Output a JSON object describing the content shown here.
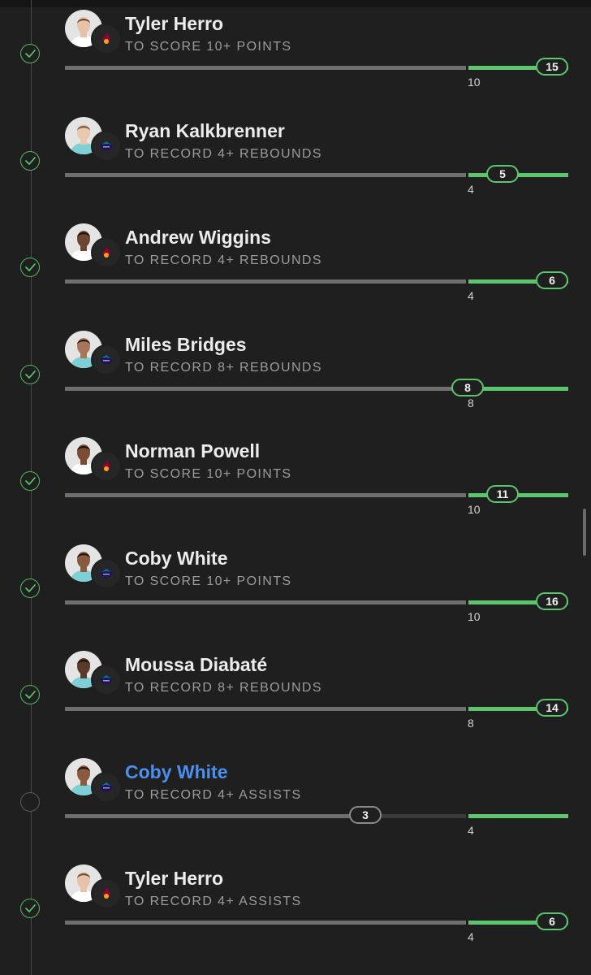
{
  "legs": [
    {
      "player": "Tyler Herro",
      "prop": "TO SCORE 10+ POINTS",
      "line": "10",
      "value": "15",
      "status": "hit",
      "team": "miami-heat",
      "jersey": "#ffffff",
      "skin": "#e8c2a8",
      "hair": "#6b4a2e",
      "progress": 1.0,
      "name_style": "default"
    },
    {
      "player": "Ryan Kalkbrenner",
      "prop": "TO RECORD 4+ REBOUNDS",
      "line": "4",
      "value": "5",
      "status": "hit",
      "team": "charlotte-hornets",
      "jersey": "#7fd0d6",
      "skin": "#e9c8b0",
      "hair": "#7a5634",
      "progress": 1.0,
      "name_style": "default"
    },
    {
      "player": "Andrew Wiggins",
      "prop": "TO RECORD 4+ REBOUNDS",
      "line": "4",
      "value": "6",
      "status": "hit",
      "team": "miami-heat",
      "jersey": "#ffffff",
      "skin": "#6e4530",
      "hair": "#1b1210",
      "progress": 1.0,
      "name_style": "default"
    },
    {
      "player": "Miles Bridges",
      "prop": "TO RECORD 8+ REBOUNDS",
      "line": "8",
      "value": "8",
      "status": "hit",
      "team": "charlotte-hornets",
      "jersey": "#7fd0d6",
      "skin": "#a8775a",
      "hair": "#231914",
      "progress": 1.0,
      "name_style": "default"
    },
    {
      "player": "Norman Powell",
      "prop": "TO SCORE 10+ POINTS",
      "line": "10",
      "value": "11",
      "status": "hit",
      "team": "miami-heat",
      "jersey": "#ffffff",
      "skin": "#7b4b33",
      "hair": "#1b1210",
      "progress": 1.0,
      "name_style": "default"
    },
    {
      "player": "Coby White",
      "prop": "TO SCORE 10+ POINTS",
      "line": "10",
      "value": "16",
      "status": "hit",
      "team": "charlotte-hornets",
      "jersey": "#7fd0d6",
      "skin": "#8a5a3f",
      "hair": "#1b1210",
      "progress": 1.0,
      "name_style": "default"
    },
    {
      "player": "Moussa Diabaté",
      "prop": "TO RECORD 8+ REBOUNDS",
      "line": "8",
      "value": "14",
      "status": "hit",
      "team": "charlotte-hornets",
      "jersey": "#7fd0d6",
      "skin": "#5c3a28",
      "hair": "#1b1210",
      "progress": 1.0,
      "name_style": "default"
    },
    {
      "player": "Coby White",
      "prop": "TO RECORD 4+ ASSISTS",
      "line": "4",
      "value": "3",
      "status": "pending",
      "team": "charlotte-hornets",
      "jersey": "#7fd0d6",
      "skin": "#8a5a3f",
      "hair": "#1b1210",
      "progress": 0.75,
      "name_style": "link"
    },
    {
      "player": "Tyler Herro",
      "prop": "TO RECORD 4+ ASSISTS",
      "line": "4",
      "value": "6",
      "status": "hit",
      "team": "miami-heat",
      "jersey": "#ffffff",
      "skin": "#e8c2a8",
      "hair": "#6b4a2e",
      "progress": 1.0,
      "name_style": "default"
    }
  ],
  "colors": {
    "background": "#1f1f1f",
    "hit": "#5cc66e",
    "track": "#6f6f6f",
    "pending_track": "#3a3a3a",
    "name": "#ececec",
    "name_link": "#4c8fef",
    "prop_text": "#9c9c9c",
    "miami_heat": "#98002e",
    "charlotte_hornets": "#1d1160"
  },
  "icons": {
    "hit": "check-icon",
    "pending": "empty-circle-icon",
    "miami-heat": "miami-heat-logo",
    "charlotte-hornets": "charlotte-hornets-logo"
  }
}
